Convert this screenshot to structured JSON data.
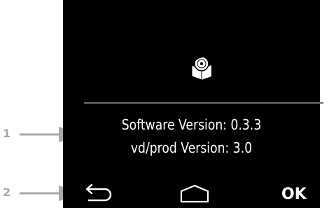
{
  "callouts": {
    "one": "1",
    "two": "2"
  },
  "info": {
    "icon": "disc-in-box-icon",
    "software_version": "Software Version: 0.3.3",
    "vd_prod_version": "vd/prod Version: 3.0"
  },
  "softkeys": {
    "back_icon": "back-arrow-icon",
    "home_icon": "home-icon",
    "ok_label": "OK"
  },
  "colors": {
    "screen_background": "#000000",
    "screen_text": "#ffffff",
    "divider": "#6e6e6e",
    "callout": "#a8a8a8"
  }
}
